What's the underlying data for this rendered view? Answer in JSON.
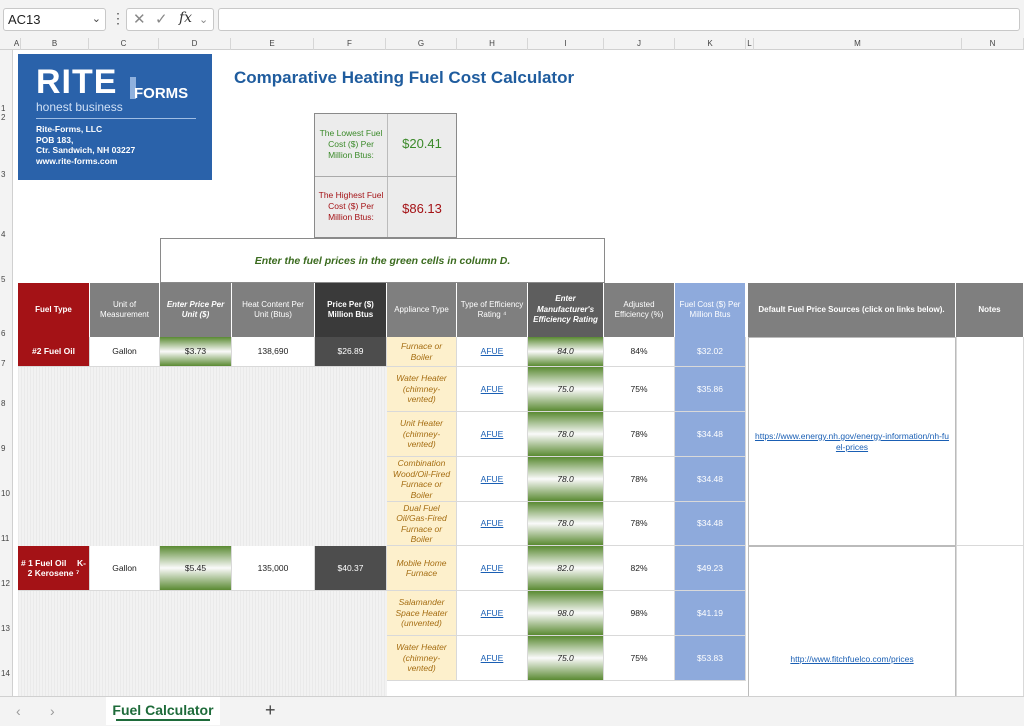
{
  "formula_bar": {
    "name_box": "AC13",
    "fx": "fx",
    "formula": ""
  },
  "columns": [
    "A",
    "B",
    "C",
    "D",
    "E",
    "F",
    "G",
    "H",
    "I",
    "J",
    "K",
    "L",
    "M",
    "N"
  ],
  "rows": [
    "1",
    "2",
    "3",
    "4",
    "5",
    "6",
    "7",
    "8",
    "9",
    "10",
    "11",
    "12",
    "13",
    "14"
  ],
  "logo": {
    "big": "RITE",
    "forms": "FORMS",
    "tagline": "honest business",
    "company": "Rite-Forms, LLC",
    "pob": "POB 183,",
    "city": "Ctr. Sandwich, NH 03227",
    "web": "www.rite-forms.com"
  },
  "title": "Comparative Heating Fuel Cost Calculator",
  "summary": {
    "lowest_label": "The Lowest Fuel Cost ($) Per Million Btus:",
    "lowest_value": "$20.41",
    "highest_label": "The Highest Fuel Cost ($) Per Million Btus:",
    "highest_value": "$86.13",
    "lowest_color": "#3b8a2a",
    "highest_color": "#a41216"
  },
  "instruction": "Enter the fuel prices in the green cells in column D.",
  "headers": {
    "fuel_type": "Fuel Type",
    "unit": "Unit of Measurement",
    "price": "Enter Price Per Unit ($)",
    "heat": "Heat Content Per Unit (Btus)",
    "price_mbtu": "Price Per ($) Million Btus",
    "appliance": "Appliance Type",
    "eff_type": "Type of Efficiency Rating ⁴",
    "mfr_eff": "Enter Manufacturer's Efficiency Rating",
    "adj_eff": "Adjusted Efficiency (%)",
    "fuel_cost": "Fuel Cost ($) Per Million Btus",
    "sources": "Default Fuel Price Sources (click on links below).",
    "notes": "Notes"
  },
  "fuel1": {
    "type": "#2 Fuel Oil",
    "unit": "Gallon",
    "price": "$3.73",
    "heat": "138,690",
    "price_mbtu": "$26.89",
    "source": "https://www.energy.nh.gov/energy-information/nh-fuel-prices",
    "rows": [
      {
        "appliance": "Furnace or Boiler",
        "rating": "AFUE",
        "mfr": "84.0",
        "adj": "84%",
        "cost": "$32.02"
      },
      {
        "appliance": "Water Heater (chimney-vented)",
        "rating": "AFUE",
        "mfr": "75.0",
        "adj": "75%",
        "cost": "$35.86"
      },
      {
        "appliance": "Unit Heater (chimney-vented)",
        "rating": "AFUE",
        "mfr": "78.0",
        "adj": "78%",
        "cost": "$34.48"
      },
      {
        "appliance": "Combination Wood/Oil-Fired Furnace or Boiler",
        "rating": "AFUE",
        "mfr": "78.0",
        "adj": "78%",
        "cost": "$34.48"
      },
      {
        "appliance": "Dual Fuel Oil/Gas-Fired Furnace or Boiler",
        "rating": "AFUE",
        "mfr": "78.0",
        "adj": "78%",
        "cost": "$34.48"
      }
    ]
  },
  "fuel2": {
    "type": "# 1 Fuel Oil",
    "type_suffix": "K-",
    "type_line2": "2 Kerosene ⁷",
    "unit": "Gallon",
    "price": "$5.45",
    "heat": "135,000",
    "price_mbtu": "$40.37",
    "source": "http://www.fitchfuelco.com/prices",
    "rows": [
      {
        "appliance": "Mobile Home Furnace",
        "rating": "AFUE",
        "mfr": "82.0",
        "adj": "82%",
        "cost": "$49.23"
      },
      {
        "appliance": "Salamander Space Heater (unvented)",
        "rating": "AFUE",
        "mfr": "98.0",
        "adj": "98%",
        "cost": "$41.19"
      },
      {
        "appliance": "Water Heater (chimney-vented)",
        "rating": "AFUE",
        "mfr": "75.0",
        "adj": "75%",
        "cost": "$53.83"
      }
    ]
  },
  "tabs": {
    "active": "Fuel Calculator",
    "add": "+",
    "prev": "‹",
    "next": "›"
  }
}
